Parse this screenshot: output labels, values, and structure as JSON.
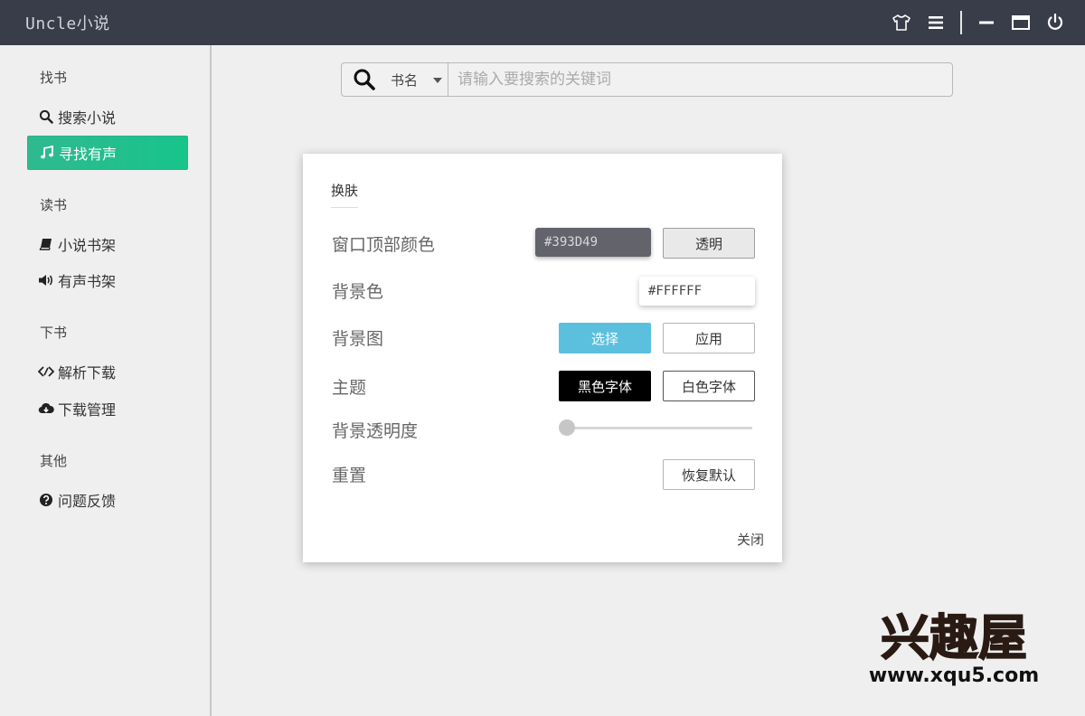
{
  "app": {
    "title": "Uncle小说"
  },
  "colors": {
    "titlebar": "#393D49",
    "active_nav": "#1dbf8b",
    "select_button": "#5bc0de"
  },
  "window_controls": [
    {
      "name": "skin-shirt-icon"
    },
    {
      "name": "menu-icon"
    },
    {
      "name": "minimize-icon"
    },
    {
      "name": "maximize-icon"
    },
    {
      "name": "power-icon"
    }
  ],
  "sidebar": {
    "groups": [
      {
        "title": "找书",
        "items": [
          {
            "label": "搜索小说",
            "icon": "search-icon",
            "active": false
          },
          {
            "label": "寻找有声",
            "icon": "music-icon",
            "active": true
          }
        ]
      },
      {
        "title": "读书",
        "items": [
          {
            "label": "小说书架",
            "icon": "book-icon",
            "active": false
          },
          {
            "label": "有声书架",
            "icon": "volume-icon",
            "active": false
          }
        ]
      },
      {
        "title": "下书",
        "items": [
          {
            "label": "解析下载",
            "icon": "parse-icon",
            "active": false
          },
          {
            "label": "下载管理",
            "icon": "cloud-download-icon",
            "active": false
          }
        ]
      },
      {
        "title": "其他",
        "items": [
          {
            "label": "问题反馈",
            "icon": "question-icon",
            "active": false
          }
        ]
      }
    ]
  },
  "search": {
    "type_selected": "书名",
    "placeholder": "请输入要搜索的关键词",
    "value": ""
  },
  "dialog": {
    "tab": "换肤",
    "rows": {
      "titlebar_color": {
        "label": "窗口顶部颜色",
        "value": "#393D49",
        "button": "透明"
      },
      "bg_color": {
        "label": "背景色",
        "value": "#FFFFFF"
      },
      "bg_image": {
        "label": "背景图",
        "select_button": "选择",
        "apply_button": "应用"
      },
      "theme": {
        "label": "主题",
        "dark_button": "黑色字体",
        "light_button": "白色字体"
      },
      "opacity": {
        "label": "背景透明度",
        "level": 0
      },
      "reset": {
        "label": "重置",
        "button": "恢复默认"
      }
    },
    "close": "关闭"
  },
  "watermark": {
    "brand": "兴趣屋",
    "url": "www.xqu5.com"
  }
}
